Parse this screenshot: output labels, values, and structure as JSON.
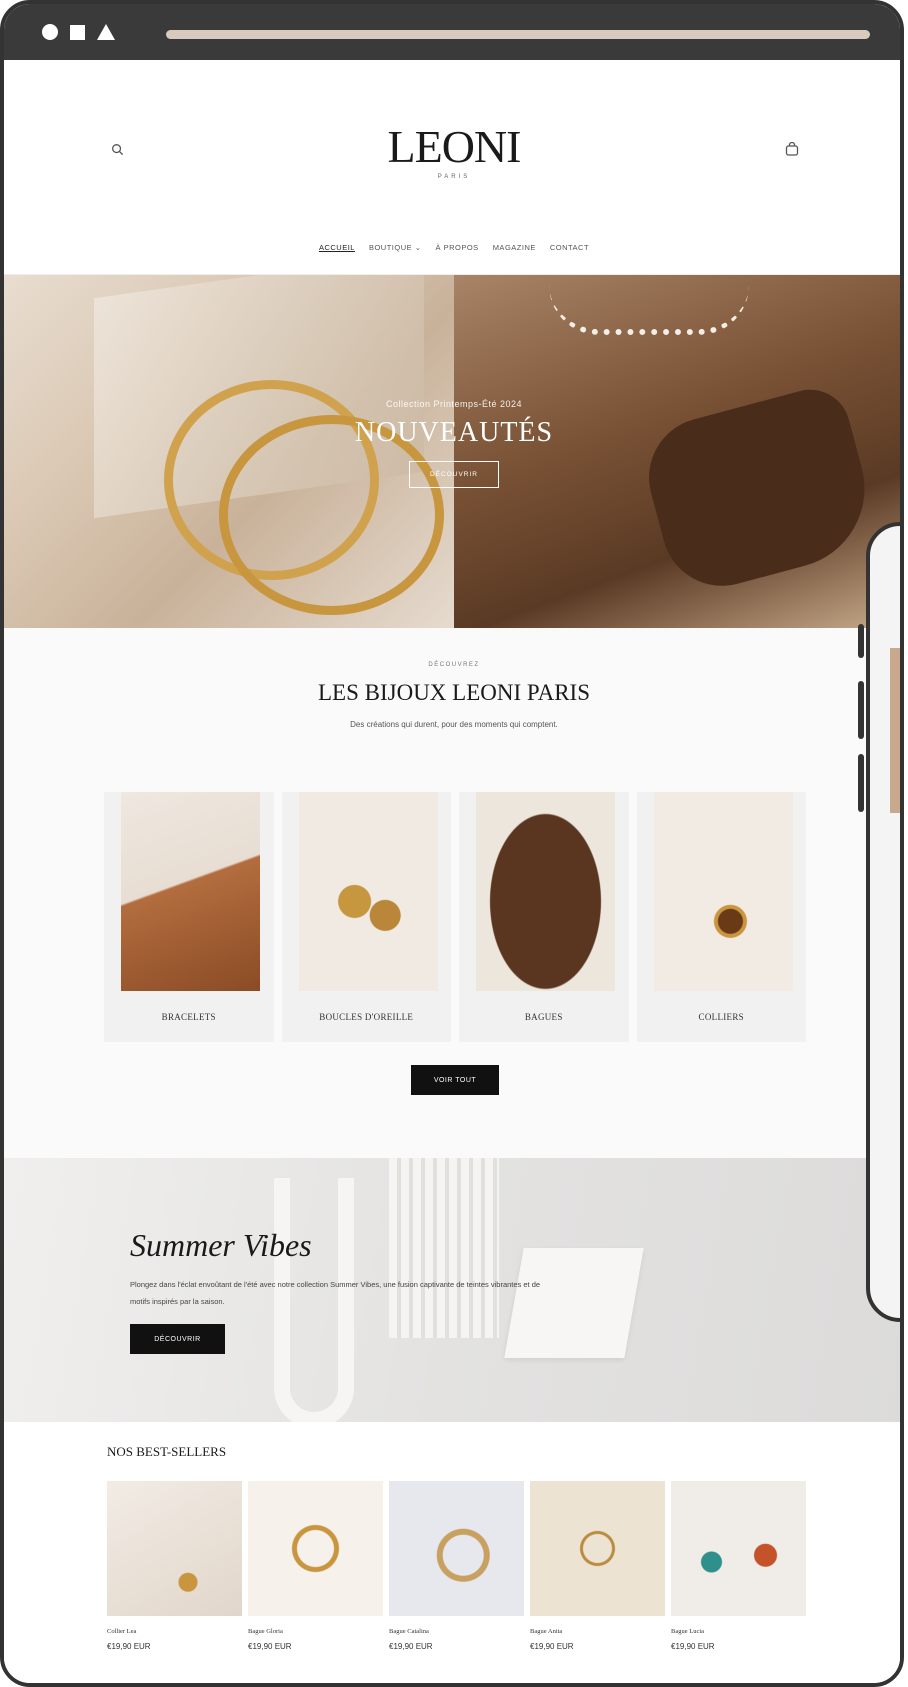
{
  "site": {
    "brand": "LEONI",
    "brand_sub": "PARIS",
    "nav": [
      "ACCUEIL",
      "BOUTIQUE ⌄",
      "À PROPOS",
      "MAGAZINE",
      "CONTACT"
    ]
  },
  "hero": {
    "eyebrow": "Collection Printemps-Été 2024",
    "title": "NOUVEAUTÉS",
    "button": "DÉCOUVRIR"
  },
  "collections": {
    "eyebrow": "DÉCOUVREZ",
    "title": "LES BIJOUX LEONI PARIS",
    "subtitle": "Des créations qui durent, pour des moments qui comptent.",
    "categories": [
      "BRACELETS",
      "BOUCLES D'OREILLE",
      "BAGUES",
      "COLLIERS"
    ],
    "view_all": "VOIR TOUT"
  },
  "summer": {
    "title": "Summer Vibes",
    "text": "Plongez dans l'éclat envoûtant de l'été avec notre collection Summer Vibes, une fusion captivante de teintes vibrantes et de motifs inspirés par la saison.",
    "button": "DÉCOUVRIR"
  },
  "bestsellers": {
    "title": "NOS BEST-SELLERS",
    "products": [
      {
        "name": "Collier Lea",
        "price": "€19,90 EUR"
      },
      {
        "name": "Bague Gloria",
        "price": "€19,90 EUR"
      },
      {
        "name": "Bague Catalina",
        "price": "€19,90 EUR"
      },
      {
        "name": "Bague Anita",
        "price": "€19,90 EUR"
      },
      {
        "name": "Bague Lucia",
        "price": "€19,90 EUR"
      }
    ]
  },
  "icons": {
    "search": "search-icon",
    "cart": "cart-icon"
  }
}
